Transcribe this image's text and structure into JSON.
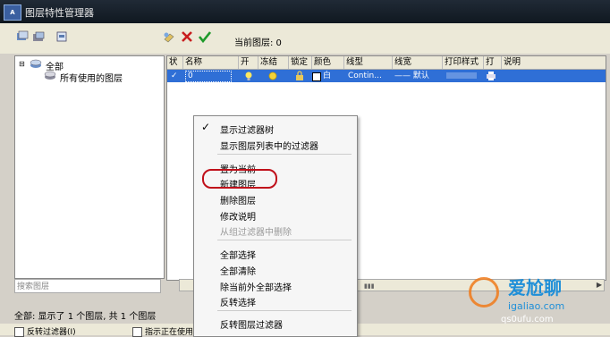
{
  "window": {
    "title": "图层特性管理器",
    "app_icon": "A"
  },
  "toolbar": {
    "current_layer_label": "当前图层: 0"
  },
  "tree": {
    "root": "全部",
    "child": "所有使用的图层"
  },
  "search": {
    "placeholder": "搜索图层"
  },
  "grid": {
    "columns": [
      "状",
      "名称",
      "开",
      "冻结",
      "锁定",
      "颜色",
      "线型",
      "线宽",
      "打印样式",
      "打",
      "说明"
    ],
    "row": {
      "status": "✓",
      "name": "0",
      "color": "白",
      "linetype": "Contin...",
      "lineweight": "—— 默认"
    }
  },
  "status_bar": {
    "text": "全部: 显示了 1 个图层, 共 1 个图层"
  },
  "bottom": {
    "invert_filter": "反转过滤器(I)",
    "apply_label": "指示正在使用"
  },
  "context_menu": {
    "items": [
      {
        "label": "显示过滤器树",
        "checked": true,
        "disabled": false
      },
      {
        "label": "显示图层列表中的过滤器",
        "checked": false,
        "disabled": false
      },
      {
        "label": "置为当前",
        "checked": false,
        "disabled": false
      },
      {
        "label": "新建图层",
        "checked": false,
        "disabled": false
      },
      {
        "label": "删除图层",
        "checked": false,
        "disabled": false
      },
      {
        "label": "修改说明",
        "checked": false,
        "disabled": false
      },
      {
        "label": "从组过滤器中删除",
        "checked": false,
        "disabled": true
      },
      {
        "label": "全部选择",
        "checked": false,
        "disabled": false
      },
      {
        "label": "全部清除",
        "checked": false,
        "disabled": false
      },
      {
        "label": "除当前外全部选择",
        "checked": false,
        "disabled": false
      },
      {
        "label": "反转选择",
        "checked": false,
        "disabled": false
      },
      {
        "label": "反转图层过滤器",
        "checked": false,
        "disabled": false
      }
    ],
    "highlight_color": "#c0101a"
  },
  "watermark": {
    "text1": "爱尬聊",
    "text2": "igaliao.com",
    "text3": "qs0ufu.com"
  }
}
